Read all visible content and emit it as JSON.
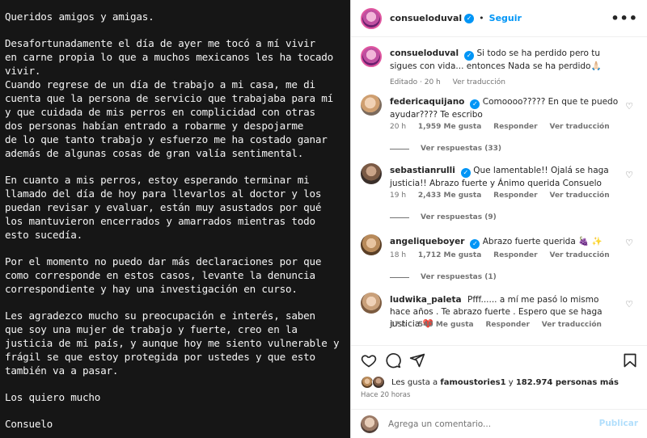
{
  "post_text": {
    "p1": "Queridos amigos y amigas.",
    "p2": "Desafortunadamente el día de ayer me tocó a mí vivir\nen carne propia lo que a muchos mexicanos les ha tocado\nvivir.",
    "p3": "Cuando regrese de un día de trabajo a mi casa, me di\ncuenta que la persona de servicio que trabajaba para mí\ny que cuidada de mis perros en complicidad con otras\ndos personas habían entrado a robarme y despojarme\nde lo que tanto trabajo y esfuerzo me ha costado ganar\nademás de algunas cosas de gran valía sentimental.",
    "p4": "En cuanto a mis perros, estoy esperando terminar mi\nllamado del día de hoy para llevarlos al doctor y los\npuedan revisar y evaluar, están muy asustados por qué\nlos mantuvieron encerrados y amarrados mientras todo\nesto sucedía.",
    "p5": "Por el momento no puedo dar más declaraciones por que\ncomo corresponde en estos casos, levante la denuncia\ncorrespondiente y hay una investigación en curso.",
    "p6": "Les agradezco mucho su preocupación e interés, saben\nque soy una mujer de trabajo y fuerte, creo en la\njusticia de mi país, y aunque hoy me siento vulnerable y\nfrágil se que estoy protegida por ustedes y que esto\ntambién va a pasar.",
    "p7": "Los quiero mucho",
    "p8": "Consuelo"
  },
  "header": {
    "username": "consueloduval",
    "separator": "•",
    "follow_label": "Seguir",
    "more_label": "•••"
  },
  "caption": {
    "username": "consueloduval",
    "text": "Si todo se ha perdido pero tu sigues con vida... entonces Nada se ha perdido🙏🏻",
    "edited": "Editado · 20 h",
    "translate": "Ver traducción"
  },
  "comments": [
    {
      "username": "federicaquijano",
      "text": "Comoooo????? En que te puedo ayudar???? Te escribo",
      "time": "20 h",
      "likes": "1,959 Me gusta",
      "reply": "Responder",
      "translate": "Ver traducción",
      "replies": "Ver respuestas (33)"
    },
    {
      "username": "sebastianrulli",
      "text": "Que lamentable!! Ojalá se haga justicia!! Abrazo fuerte y Ánimo querida Consuelo",
      "time": "19 h",
      "likes": "2,433 Me gusta",
      "reply": "Responder",
      "translate": "Ver traducción",
      "replies": "Ver respuestas (9)"
    },
    {
      "username": "angeliqueboyer",
      "text": "Abrazo fuerte querida 🍇 ✨",
      "time": "18 h",
      "likes": "1,712 Me gusta",
      "reply": "Responder",
      "translate": "Ver traducción",
      "replies": "Ver respuestas (1)"
    },
    {
      "username": "ludwika_paleta",
      "text": "Pfff...... a mí me pasó lo mismo hace años . Te abrazo fuerte . Espero que se haga justicia ❤️",
      "time": "17 h",
      "likes": "540 Me gusta",
      "reply": "Responder",
      "translate": "Ver traducción"
    }
  ],
  "likes_summary": {
    "prefix": "Les gusta a",
    "user": "famoustories1",
    "middle": "y",
    "count": "182.974 personas más"
  },
  "posted_ago": "Hace 20 horas",
  "composer": {
    "placeholder": "Agrega un comentario...",
    "publish_label": "Publicar"
  },
  "icons": {
    "like": "heart-icon",
    "comment": "comment-icon",
    "share": "share-icon",
    "save": "bookmark-icon",
    "emoji": "emoji-icon"
  },
  "colors": {
    "accent": "#0095f6",
    "publish_disabled": "#b2dffc",
    "post_background": "#161616"
  }
}
